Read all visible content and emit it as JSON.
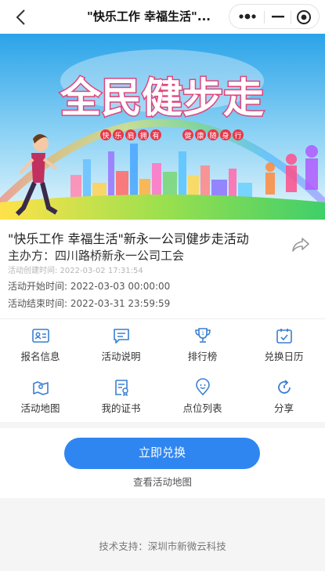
{
  "navbar": {
    "title": "\"快乐工作  幸福生活\"..."
  },
  "banner": {
    "headline": "全民健步走",
    "tag_left": [
      "快",
      "乐",
      "肩",
      "拥",
      "有"
    ],
    "tag_right": [
      "健",
      "康",
      "随",
      "身",
      "行"
    ]
  },
  "activity": {
    "title": "\"快乐工作 幸福生活\"新永一公司健步走活动",
    "organizer": "主办方：四川路桥新永一公司工会",
    "created": "活动创建时间: 2022-03-02 17:31:54",
    "start": "活动开始时间: 2022-03-03 00:00:00",
    "end": "活动结束时间: 2022-03-31 23:59:59"
  },
  "menu": {
    "items": [
      {
        "label": "报名信息",
        "icon": "id-card-icon"
      },
      {
        "label": "活动说明",
        "icon": "message-icon"
      },
      {
        "label": "排行榜",
        "icon": "trophy-icon"
      },
      {
        "label": "兑换日历",
        "icon": "calendar-check-icon"
      },
      {
        "label": "活动地图",
        "icon": "map-icon"
      },
      {
        "label": "我的证书",
        "icon": "certificate-icon"
      },
      {
        "label": "点位列表",
        "icon": "location-list-icon"
      },
      {
        "label": "分享",
        "icon": "share-refresh-icon"
      }
    ]
  },
  "actions": {
    "redeem_label": "立即兑换",
    "map_link": "查看活动地图"
  },
  "footer": {
    "support": "技术支持：深圳市新微云科技"
  },
  "colors": {
    "accent": "#2f86f0",
    "icon_blue": "#3a7fd0"
  }
}
